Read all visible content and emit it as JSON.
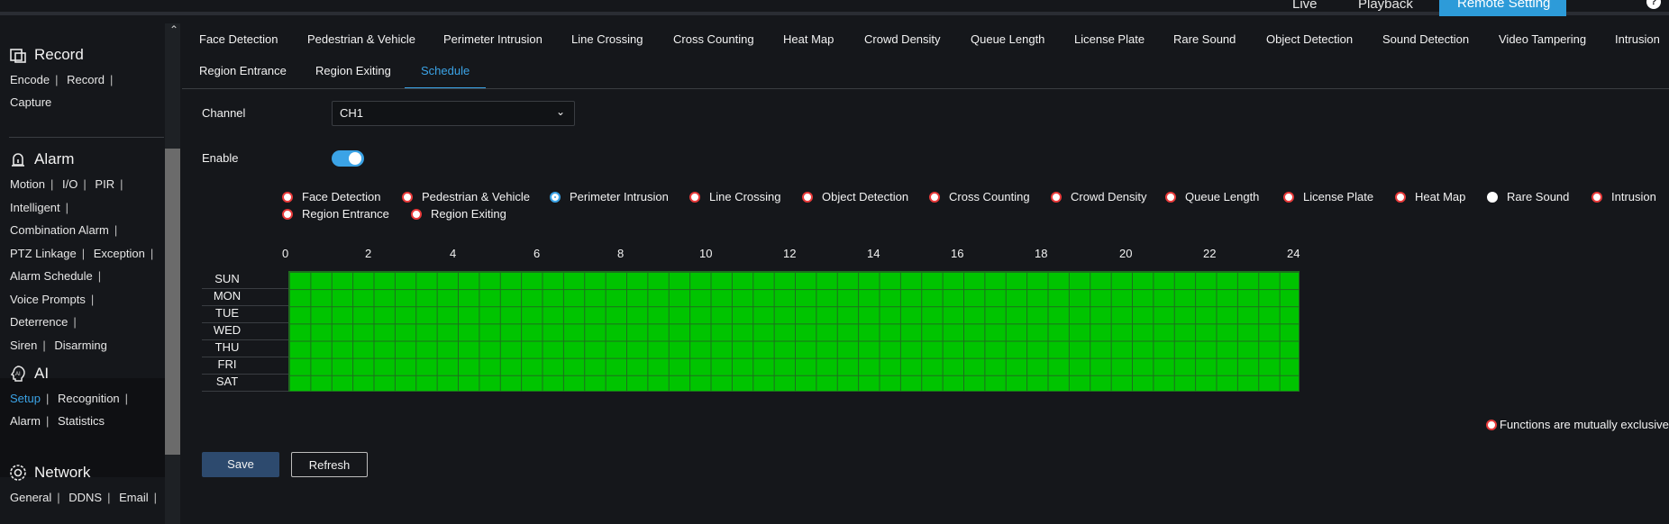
{
  "topnav": {
    "items": [
      "Live",
      "Playback"
    ],
    "active": "Remote Setting",
    "help": "?"
  },
  "sidebar": {
    "sections": [
      {
        "title": "Record",
        "icon": "record-icon",
        "links": [
          "Encode",
          "Record",
          "Capture"
        ]
      },
      {
        "title": "Alarm",
        "icon": "alarm-icon",
        "links": [
          "Motion",
          "I/O",
          "PIR",
          "Intelligent",
          "Combination Alarm",
          "PTZ Linkage",
          "Exception",
          "Alarm Schedule",
          "Voice Prompts",
          "Deterrence",
          "Siren",
          "Disarming"
        ]
      },
      {
        "title": "AI",
        "icon": "ai-icon",
        "links": [
          "Setup",
          "Recognition",
          "Alarm",
          "Statistics"
        ],
        "active_link": "Setup"
      },
      {
        "title": "Network",
        "icon": "network-icon",
        "links": [
          "General",
          "DDNS",
          "Email"
        ]
      }
    ]
  },
  "tabs": {
    "row1": [
      "Face Detection",
      "Pedestrian & Vehicle",
      "Perimeter Intrusion",
      "Line Crossing",
      "Cross Counting",
      "Heat Map",
      "Crowd Density",
      "Queue Length",
      "License Plate",
      "Rare Sound",
      "Object Detection",
      "Sound Detection",
      "Video Tampering",
      "Intrusion"
    ],
    "row2": [
      "Region Entrance",
      "Region Exiting",
      "Schedule"
    ],
    "active": "Schedule"
  },
  "form": {
    "channel_label": "Channel",
    "channel_value": "CH1",
    "enable_label": "Enable",
    "enable_on": true
  },
  "radios": [
    {
      "label": "Face Detection",
      "state": "red"
    },
    {
      "label": "Pedestrian & Vehicle",
      "state": "red"
    },
    {
      "label": "Perimeter Intrusion",
      "state": "selected"
    },
    {
      "label": "Line Crossing",
      "state": "red"
    },
    {
      "label": "Object Detection",
      "state": "red"
    },
    {
      "label": "Cross Counting",
      "state": "red"
    },
    {
      "label": "Crowd Density",
      "state": "red"
    },
    {
      "label": "Queue Length",
      "state": "red"
    },
    {
      "label": "License Plate",
      "state": "red"
    },
    {
      "label": "Heat Map",
      "state": "red"
    },
    {
      "label": "Rare Sound",
      "state": "white"
    },
    {
      "label": "Intrusion",
      "state": "red"
    },
    {
      "label": "Region Entrance",
      "state": "red"
    },
    {
      "label": "Region Exiting",
      "state": "red"
    }
  ],
  "schedule": {
    "hours": [
      "0",
      "2",
      "4",
      "6",
      "8",
      "10",
      "12",
      "14",
      "16",
      "18",
      "20",
      "22",
      "24"
    ],
    "days": [
      "SUN",
      "MON",
      "TUE",
      "WED",
      "THU",
      "FRI",
      "SAT"
    ],
    "fill_color": "#00c400",
    "all_selected": true
  },
  "legend": {
    "text": "Functions are mutually exclusive"
  },
  "buttons": {
    "save": "Save",
    "refresh": "Refresh"
  }
}
